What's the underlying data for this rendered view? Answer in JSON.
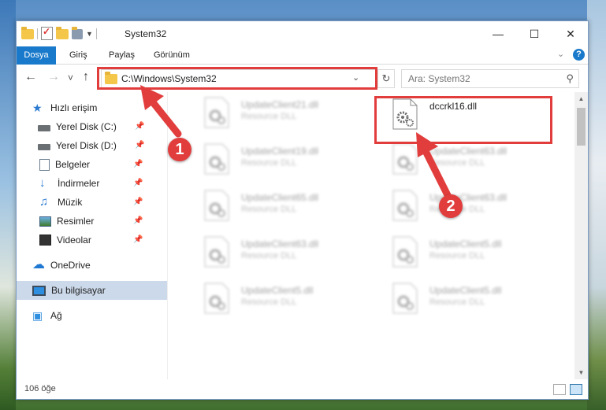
{
  "window": {
    "title": "System32",
    "minimize_label": "—",
    "maximize_label": "☐",
    "close_label": "✕"
  },
  "ribbon": {
    "tabs": [
      "Dosya",
      "Giriş",
      "Paylaş",
      "Görünüm"
    ]
  },
  "navbar": {
    "back": "←",
    "forward": "→",
    "recent": "˅",
    "up": "↑",
    "address": "C:\\Windows\\System32",
    "refresh": "↻",
    "search_placeholder": "Ara: System32"
  },
  "sidebar": {
    "items": [
      {
        "label": "Hızlı erişim",
        "icon": "star-icon"
      },
      {
        "label": "Yerel Disk (C:)",
        "icon": "drive-icon",
        "pinned": true
      },
      {
        "label": "Yerel Disk (D:)",
        "icon": "drive-icon",
        "pinned": true
      },
      {
        "label": "Belgeler",
        "icon": "documents-icon",
        "pinned": true
      },
      {
        "label": "İndirmeler",
        "icon": "download-icon",
        "pinned": true
      },
      {
        "label": "Müzik",
        "icon": "music-icon",
        "pinned": true
      },
      {
        "label": "Resimler",
        "icon": "pictures-icon",
        "pinned": true
      },
      {
        "label": "Videolar",
        "icon": "videos-icon",
        "pinned": true
      },
      {
        "label": "OneDrive",
        "icon": "onedrive-icon"
      },
      {
        "label": "Bu bilgisayar",
        "icon": "this-pc-icon",
        "selected": true
      },
      {
        "label": "Ağ",
        "icon": "network-icon"
      }
    ]
  },
  "files": {
    "left": [
      {
        "name": "UpdateClient21.dll",
        "type": "Resource DLL"
      },
      {
        "name": "UpdateClient19.dll",
        "type": "Resource DLL"
      },
      {
        "name": "UpdateClient65.dll",
        "type": "Resource DLL"
      },
      {
        "name": "UpdateClient63.dll",
        "type": "Resource DLL"
      },
      {
        "name": "UpdateClient5.dll",
        "type": "Resource DLL"
      }
    ],
    "right": [
      {
        "name": "dccrkl16.dll",
        "type": ""
      },
      {
        "name": "UpdateClient63.dll",
        "type": "Resource DLL"
      },
      {
        "name": "UpdateClient63.dll",
        "type": "Resource DLL"
      },
      {
        "name": "UpdateClient5.dll",
        "type": "Resource DLL"
      },
      {
        "name": "UpdateClient5.dll",
        "type": "Resource DLL"
      }
    ]
  },
  "status": {
    "count": "106 öğe"
  },
  "callouts": {
    "one": "1",
    "two": "2"
  },
  "colors": {
    "accent": "#1979ca",
    "highlight": "#e23d3d"
  }
}
